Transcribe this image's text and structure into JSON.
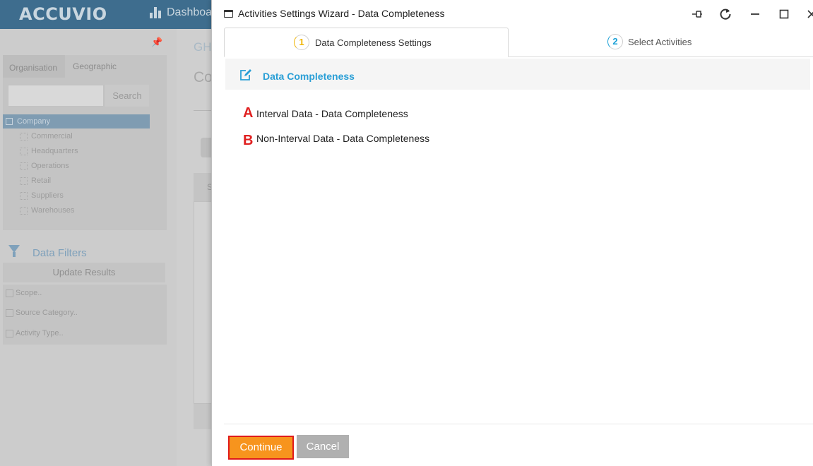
{
  "app": {
    "logo": "ACCUVIO",
    "nav_item": "Dashboa"
  },
  "left_panel": {
    "tabs": [
      "Organisation",
      "Geographic"
    ],
    "search_button": "Search",
    "tree_root": "Company",
    "tree_items": [
      "Commercial",
      "Headquarters",
      "Operations",
      "Retail",
      "Suppliers",
      "Warehouses"
    ],
    "filters_title": "Data Filters",
    "update_button": "Update Results",
    "filters": [
      "Scope..",
      "Source Category..",
      "Activity Type.."
    ]
  },
  "main_bg": {
    "heading_fragment": "GH",
    "title_fragment": "Co",
    "tab_fragment": "S"
  },
  "modal": {
    "title": "Activities Settings Wizard - Data Completeness",
    "steps": [
      {
        "number": "1",
        "label": "Data Completeness Settings",
        "accent": "#f0b400"
      },
      {
        "number": "2",
        "label": "Select Activities",
        "accent": "#1aa0d6"
      }
    ],
    "section_title": "Data Completeness",
    "links": [
      {
        "marker": "A",
        "text": "Interval Data - Data Completeness"
      },
      {
        "marker": "B",
        "text": "Non-Interval Data - Data Completeness"
      }
    ],
    "continue_label": "Continue",
    "cancel_label": "Cancel"
  },
  "colors": {
    "accent_blue": "#2a9fd6",
    "continue_orange": "#f7941d",
    "annotation_red": "#e02020"
  }
}
